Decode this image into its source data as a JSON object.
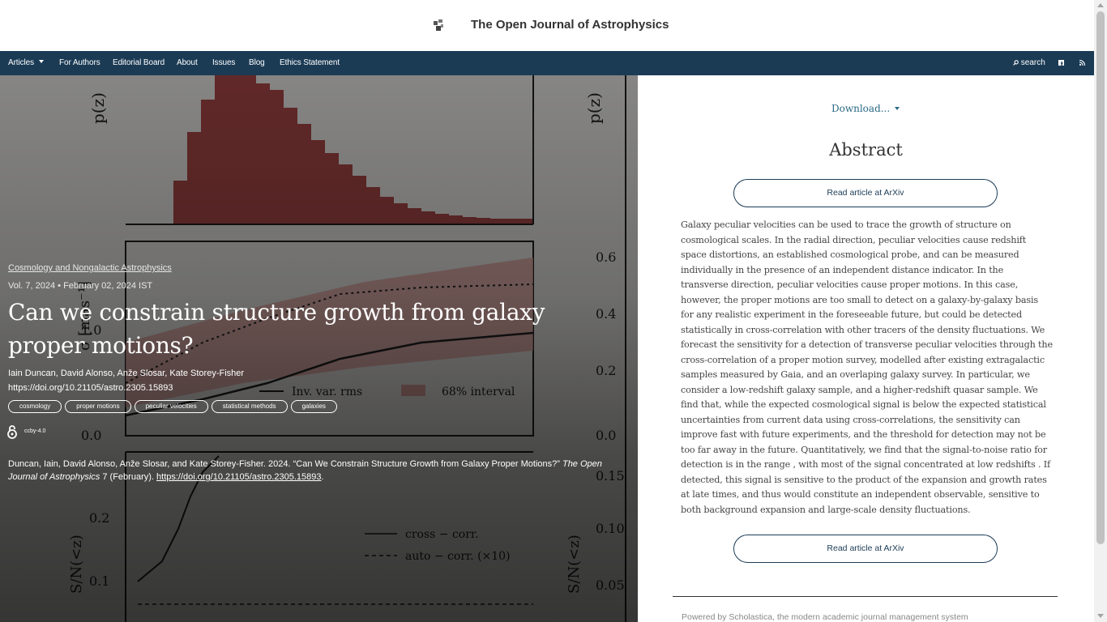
{
  "header": {
    "site_title": "The Open Journal of Astrophysics",
    "logo_icon": "journal-logo-icon"
  },
  "nav": {
    "items": [
      {
        "label": "Articles",
        "has_dropdown": true
      },
      {
        "label": "For Authors"
      },
      {
        "label": "Editorial Board"
      },
      {
        "label": "About"
      },
      {
        "label": "Issues"
      },
      {
        "label": "Blog"
      },
      {
        "label": "Ethics Statement"
      }
    ],
    "search_label": "search",
    "search_icon": "search-icon",
    "facebook_icon": "facebook-icon",
    "rss_icon": "rss-icon",
    "background_color": "#1b3b55"
  },
  "article": {
    "category": "Cosmology and Nongalactic Astrophysics",
    "volume_date": "Vol. 7, 2024 • February 02, 2024 IST",
    "title": "Can we constrain structure growth from galaxy proper motions?",
    "authors": "Iain Duncan, David Alonso, Anže Slosar, Kate Storey-Fisher",
    "doi": "https://doi.org/10.21105/astro.2305.15893",
    "tags": [
      "cosmology",
      "proper motions",
      "peculiar velocities",
      "statistical methods",
      "galaxies"
    ],
    "license": "ccby-4.0",
    "open_access_icon": "open-access-icon",
    "citation_prefix": "Duncan, Iain, David Alonso, Anže Slosar, and Kate Storey-Fisher. 2024. “Can We Constrain Structure Growth from Galaxy Proper Motions?”",
    "citation_journal": "The Open Journal of Astrophysics",
    "citation_suffix": "7 (February).",
    "citation_doi": "https://doi.org/10.21105/astro.2305.15893"
  },
  "right_panel": {
    "download_label": "Download...",
    "abstract_heading": "Abstract",
    "read_arxiv_label": "Read article at ArXiv",
    "abstract": "Galaxy peculiar velocities can be used to trace the growth of structure on cosmological scales. In the radial direction, peculiar velocities cause redshift space distortions, an established cosmological probe, and can be measured individually in the presence of an independent distance indicator. In the transverse direction, peculiar velocities cause proper motions. In this case, however, the proper motions are too small to detect on a galaxy-by-galaxy basis for any realistic experiment in the foreseeable future, but could be detected statistically in cross-correlation with other tracers of the density fluctuations. We forecast the sensitivity for a detection of transverse peculiar velocities through the cross-correlation of a proper motion survey, modelled after existing extragalactic samples measured by Gaia, and an overlaping galaxy survey. In particular, we consider a low-redshift galaxy sample, and a higher-redshift quasar sample. We find that, while the expected cosmological signal is below the expected statistical uncertainties from current data using cross-correlations, the sensitivity can improve fast with future experiments, and the threshold for detection may not be too far away in the future. Quantitatively, we find that the signal-to-noise ratio for detection is in the range              , with most of the signal concentrated at low redshifts             . If detected, this signal is sensitive to the product of the expansion and growth rates at late times, and thus would constitute an independent observable, sensitive to both background expansion and large-scale density fluctuations.",
    "powered_by": "Powered by Scholastica, the modern academic journal management system"
  }
}
